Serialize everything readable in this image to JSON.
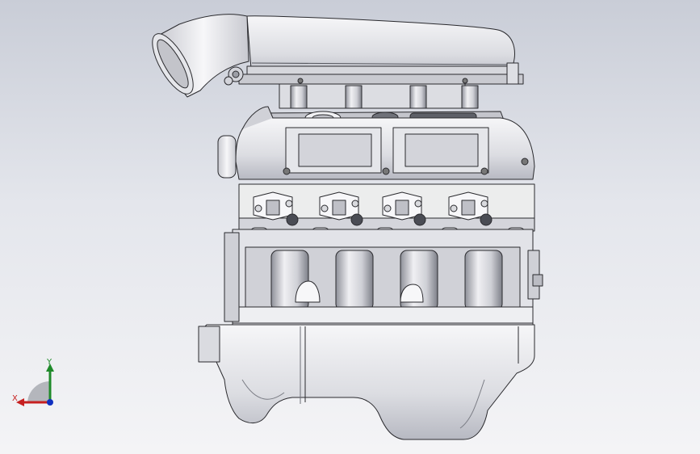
{
  "viewport": {
    "background_top": "#c9cdd7",
    "background_bottom": "#f4f4f6",
    "model": "v8-engine-assembly",
    "render_style": "shaded-with-edges"
  },
  "triad": {
    "x_label": "X",
    "y_label": "Y",
    "x_color": "#c62020",
    "y_color": "#1f8a2a",
    "z_color": "#1030c0"
  },
  "colors": {
    "part_fill": "#e9eaee",
    "part_shade": "#b9bcc6",
    "edge": "#2a2a2e"
  }
}
